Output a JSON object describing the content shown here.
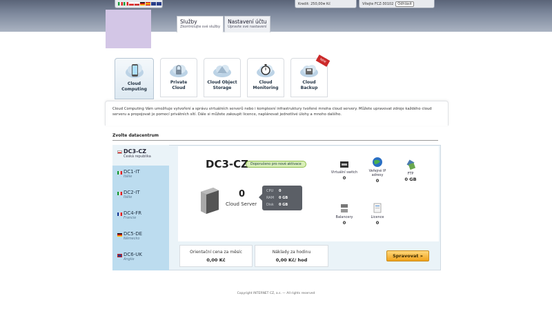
{
  "header": {
    "credit": "Kredit: 250,00м Kč",
    "user": "Vítejte FCZ-30102",
    "logout_label": "Odhlásit"
  },
  "topnav": [
    {
      "title": "Služby",
      "subtitle": "Zkontrolujte své služby"
    },
    {
      "title": "Nastavení účtu",
      "subtitle": "Upravte své nastavení"
    }
  ],
  "tabs": [
    {
      "label_1": "Cloud",
      "label_2": "Computing",
      "icon": "cloud-phone-icon"
    },
    {
      "label_1": "Private",
      "label_2": "Cloud",
      "icon": "cloud-lock-icon"
    },
    {
      "label_1": "Cloud Object",
      "label_2": "Storage",
      "icon": "cloud-storage-icon"
    },
    {
      "label_1": "Cloud",
      "label_2": "Monitoring",
      "icon": "cloud-stopwatch-icon"
    },
    {
      "label_1": "Cloud",
      "label_2": "Backup",
      "icon": "cloud-backup-icon",
      "ribbon": "NEW"
    }
  ],
  "description": "Cloud Computing Vám umožňuje vytvoření a správu virtuálních serverů nebo i komplexní infrastruktury tvořené mnoha cloud servery. Můžete upravovat zdroje každého cloud serveru a propojovat je pomocí privátních sítí. Dále si můžete zakoupit licence, naplánovat jednotlivé úlohy a mnoho dalšího.",
  "datacenter_title": "Zvolte datacentrum",
  "datacenters": [
    {
      "code": "DC3-CZ",
      "country": "Česká republika",
      "flag": "cz"
    },
    {
      "code": "DC1-IT",
      "country": "Itálie",
      "flag": "it"
    },
    {
      "code": "DC2-IT",
      "country": "Itálie",
      "flag": "it"
    },
    {
      "code": "DC4-FR",
      "country": "Francie",
      "flag": "fr"
    },
    {
      "code": "DC5-DE",
      "country": "Německo",
      "flag": "de"
    },
    {
      "code": "DC6-UK",
      "country": "Anglie",
      "flag": "uk"
    }
  ],
  "selected": {
    "code": "DC3-CZ",
    "badge": "Doporučeno pro nové aktivace",
    "server_count": "0",
    "server_label": "Cloud Server",
    "specs": [
      {
        "k": "CPU",
        "v": "0"
      },
      {
        "k": "RAM",
        "v": "0 GB"
      },
      {
        "k": "Disk",
        "v": "0 GB"
      }
    ]
  },
  "services": {
    "switch": {
      "name": "Virtuální switch",
      "value": "0"
    },
    "ip": {
      "name_1": "Veřejné IP",
      "name_2": "adresy",
      "value": "0"
    },
    "ftp": {
      "name": "FTP",
      "value": "0 GB"
    },
    "balancer": {
      "name": "Balancery",
      "value": "0"
    },
    "licence": {
      "name": "Licence",
      "value": "0"
    }
  },
  "prices": {
    "monthly_label": "Orientační cena za měsíc",
    "monthly_value": "0,00 Kč",
    "hourly_label": "Náklady za hodinu",
    "hourly_value": "0,00 Kč/ hod"
  },
  "manage_label": "Spravovat »",
  "footer": "Copyright INTERNET CZ, a.s. — All rights reserved",
  "colors": {
    "accent": "#f0a21c",
    "list_bg": "#bcdcef",
    "panel_bg": "#eaf3f8"
  }
}
